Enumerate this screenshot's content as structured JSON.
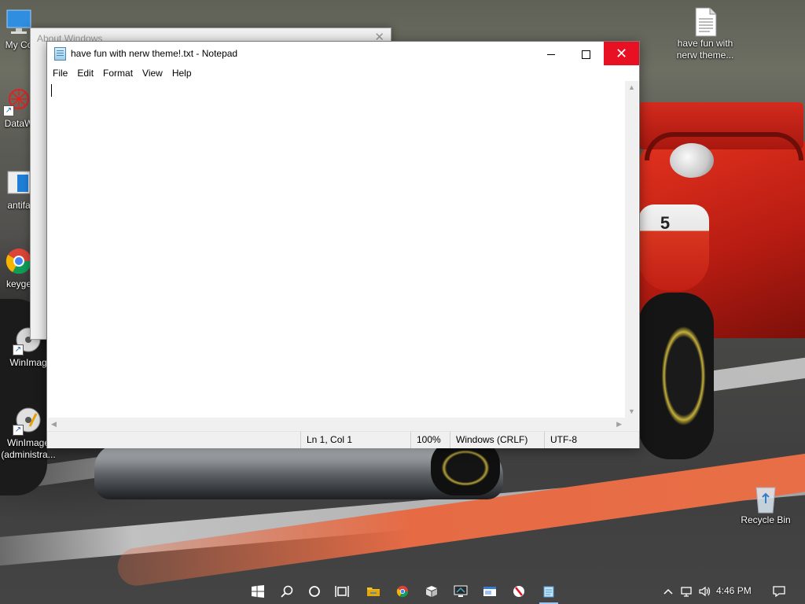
{
  "desktop": {
    "icons_left": [
      {
        "name": "my-computer-icon",
        "label": "My Co"
      },
      {
        "name": "datawrapper-icon",
        "label": "DataW"
      },
      {
        "name": "antifa-icon",
        "label": "antifa"
      },
      {
        "name": "chrome-icon",
        "label": "keyge"
      },
      {
        "name": "winimage-icon",
        "label": "WinImag"
      },
      {
        "name": "winimage-admin-icon",
        "label": "WinImage (administra..."
      }
    ],
    "icon_right_top": {
      "label": "have fun with nerw theme..."
    },
    "recycle_bin": {
      "label": "Recycle Bin"
    },
    "car_number": "5"
  },
  "about_window": {
    "title": "About Windows",
    "close_glyph": "✕"
  },
  "notepad": {
    "title": "have fun with nerw theme!.txt - Notepad",
    "close_glyph": "✕",
    "menu": [
      "File",
      "Edit",
      "Format",
      "View",
      "Help"
    ],
    "content": "",
    "status": {
      "position": "Ln 1, Col 1",
      "zoom": "100%",
      "line_endings": "Windows (CRLF)",
      "encoding": "UTF-8"
    }
  },
  "taskbar": {
    "icons": [
      "windows-start-icon",
      "search-icon",
      "cortana-icon",
      "task-view-icon",
      "file-explorer-icon",
      "chrome-icon",
      "package-icon",
      "remote-desktop-icon",
      "window-app-icon",
      "opera-icon",
      "notepad-icon"
    ],
    "tray": {
      "chevron": "^",
      "time": "4:46 PM"
    }
  },
  "colors": {
    "close_red": "#e81123",
    "taskbar_active": "#9dc6f3"
  }
}
